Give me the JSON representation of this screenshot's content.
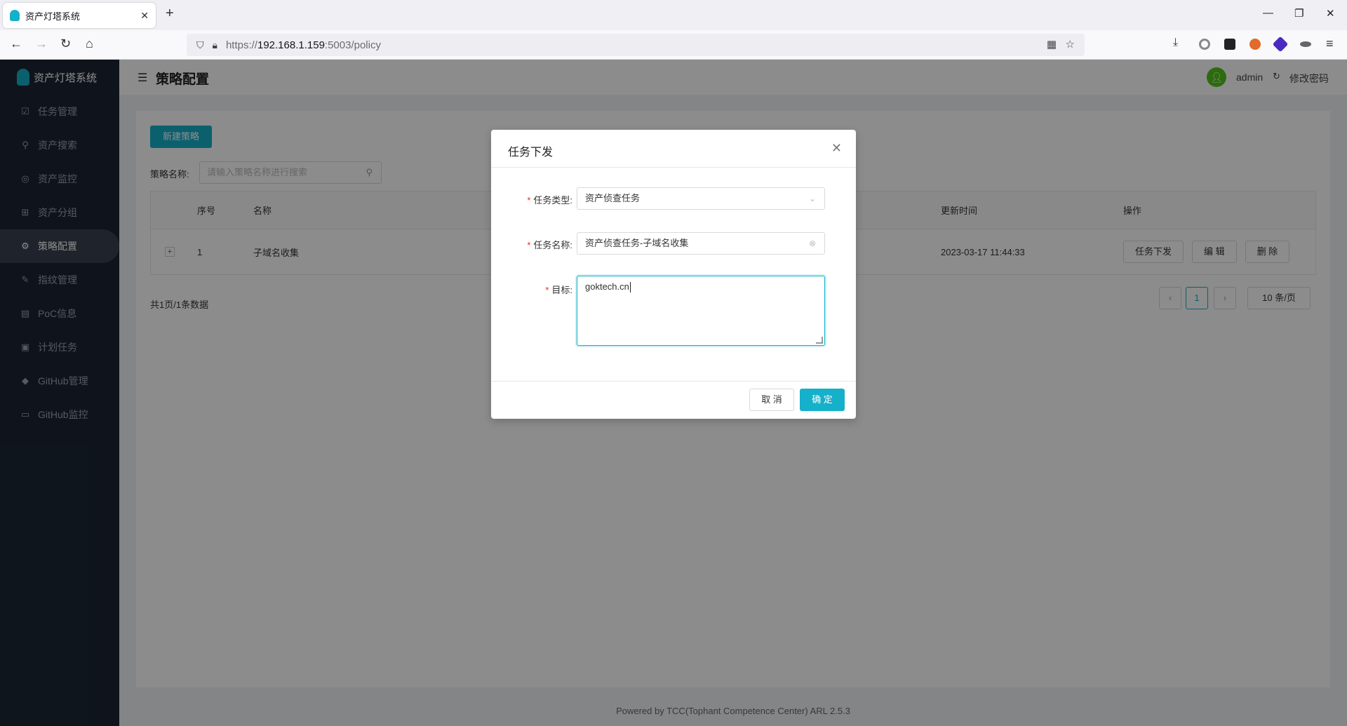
{
  "browser": {
    "tab_title": "资产灯塔系统",
    "url_prefix": "https://",
    "url_host": "192.168.1.159",
    "url_rest": ":5003/policy"
  },
  "app": {
    "logo_text": "资产灯塔系统",
    "menu": [
      {
        "label": "任务管理",
        "icon": "task-icon"
      },
      {
        "label": "资产搜索",
        "icon": "search-icon"
      },
      {
        "label": "资产监控",
        "icon": "monitor-icon"
      },
      {
        "label": "资产分组",
        "icon": "group-icon"
      },
      {
        "label": "策略配置",
        "icon": "gear-icon",
        "active": true
      },
      {
        "label": "指纹管理",
        "icon": "fingerprint-icon"
      },
      {
        "label": "PoC信息",
        "icon": "document-icon"
      },
      {
        "label": "计划任务",
        "icon": "schedule-icon"
      },
      {
        "label": "GitHub管理",
        "icon": "github-icon"
      },
      {
        "label": "GitHub监控",
        "icon": "screen-icon"
      }
    ],
    "header": {
      "title": "策略配置",
      "user": "admin",
      "change_password": "修改密码"
    },
    "toolbar": {
      "new_policy": "新建策略",
      "search_label": "策略名称:",
      "search_placeholder": "请输入策略名称进行搜索"
    },
    "table": {
      "columns": [
        "序号",
        "名称",
        "更新时间",
        "操作"
      ],
      "rows": [
        {
          "index": "1",
          "name": "子域名收集",
          "updated": "2023-03-17 11:44:33",
          "actions": [
            "任务下发",
            "编 辑",
            "删 除"
          ]
        }
      ],
      "expand_symbol": "+"
    },
    "pagination": {
      "summary": "共1页/1条数据",
      "prev": "‹",
      "current": "1",
      "next": "›",
      "page_size": "10 条/页"
    },
    "footer": "Powered by TCC(Tophant Competence Center) ARL 2.5.3"
  },
  "modal": {
    "title": "任务下发",
    "fields": {
      "type_label": "任务类型:",
      "type_value": "资产侦查任务",
      "name_label": "任务名称:",
      "name_value": "资产侦查任务-子域名收集",
      "target_label": "目标:",
      "target_value": "goktech.cn"
    },
    "cancel": "取 消",
    "ok": "确 定"
  },
  "colors": {
    "accent": "#15b0c9",
    "sidebar": "#1c2633",
    "required": "#f5222d"
  }
}
